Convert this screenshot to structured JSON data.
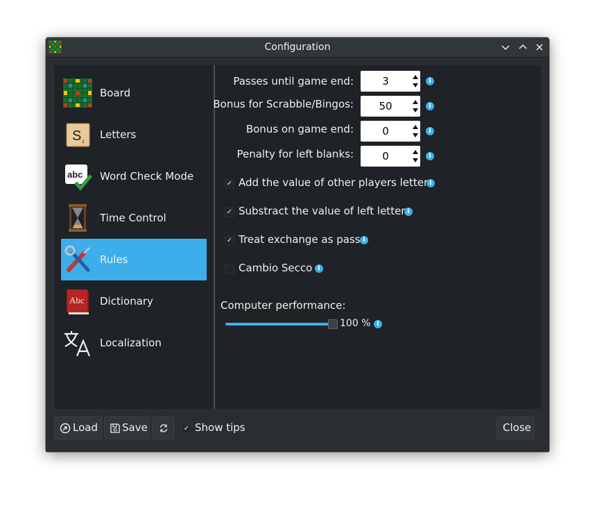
{
  "window": {
    "title": "Configuration"
  },
  "titlebar": {
    "minimize_icon": "chevron-down-icon",
    "maximize_icon": "chevron-up-icon",
    "close_icon": "close-icon"
  },
  "nav": {
    "items": [
      {
        "label": "Board",
        "icon": "board-icon"
      },
      {
        "label": "Letters",
        "icon": "letter-tile-icon"
      },
      {
        "label": "Word Check Mode",
        "icon": "abc-check-icon"
      },
      {
        "label": "Time Control",
        "icon": "hourglass-icon"
      },
      {
        "label": "Rules",
        "icon": "tools-icon",
        "selected": true
      },
      {
        "label": "Dictionary",
        "icon": "book-icon"
      },
      {
        "label": "Localization",
        "icon": "translate-icon"
      }
    ]
  },
  "rules": {
    "fields": [
      {
        "label": "Passes until game end:",
        "value": "3"
      },
      {
        "label": "Bonus for Scrabble/Bingos:",
        "value": "50"
      },
      {
        "label": "Bonus on game end:",
        "value": "0"
      },
      {
        "label": "Penalty for left blanks:",
        "value": "0"
      }
    ],
    "options": [
      {
        "label": "Add the value of other players letters",
        "checked": true
      },
      {
        "label": "Substract the value of left letters",
        "checked": true
      },
      {
        "label": "Treat exchange as pass",
        "checked": true
      },
      {
        "label": "Cambio Secco",
        "checked": false
      }
    ],
    "performance": {
      "label": "Computer performance:",
      "value_text": "100 %",
      "value": 100
    },
    "info_glyph": "i"
  },
  "footer": {
    "load_label": "Load",
    "save_label": "Save",
    "show_tips_label": "Show tips",
    "show_tips_checked": true,
    "close_label": "Close"
  },
  "colors": {
    "accent": "#3daee9",
    "window_bg": "#2a2e32",
    "content_bg": "#1f2226"
  }
}
